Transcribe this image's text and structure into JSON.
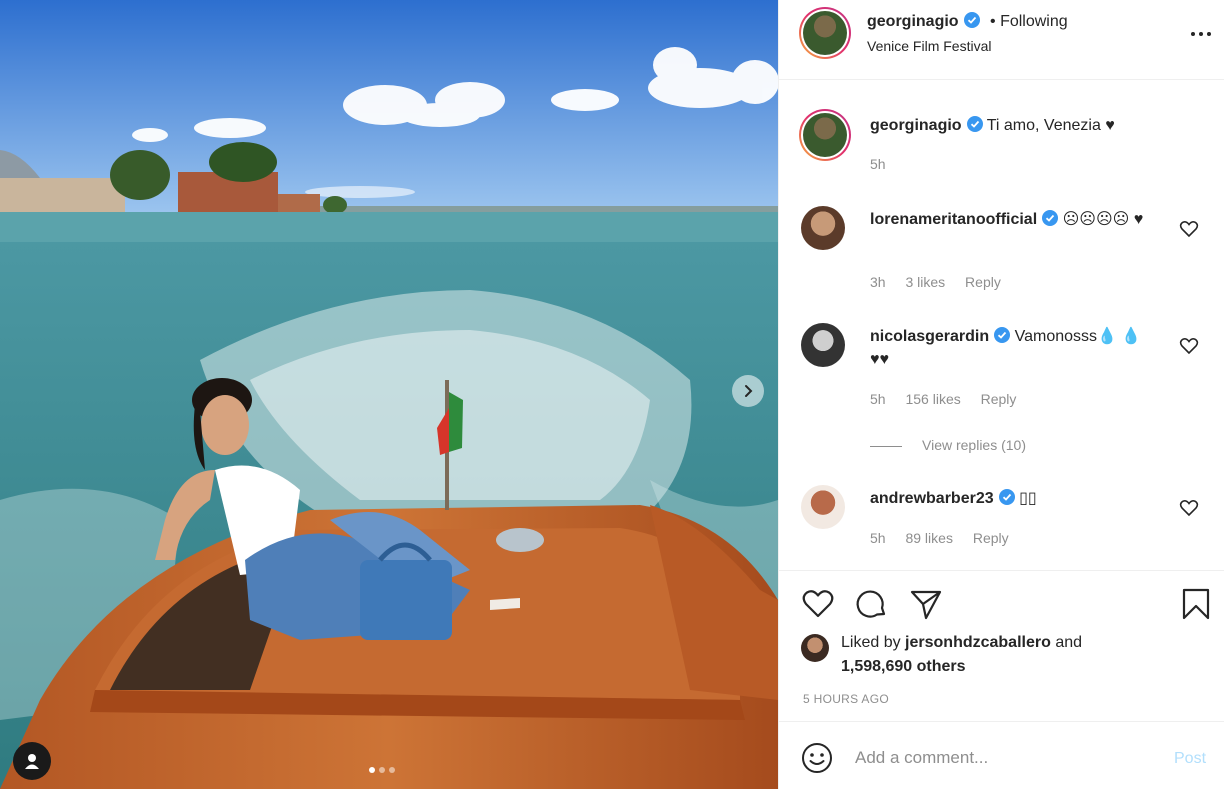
{
  "post": {
    "username": "georginagio",
    "follow_status": "• Following",
    "location": "Venice Film Festival",
    "caption": "Ti amo, Venezia ♥",
    "caption_age": "5h",
    "carousel": {
      "slides": 3,
      "active": 1
    }
  },
  "comments": [
    {
      "username": "lorenameritanoofficial",
      "text": "☹☹☹☹ ♥",
      "age": "3h",
      "likes": "3 likes",
      "reply_label": "Reply",
      "verified": true
    },
    {
      "username": "nicolasgerardin",
      "text": "Vamonosss💧 💧♥♥",
      "age": "5h",
      "likes": "156 likes",
      "reply_label": "Reply",
      "verified": true,
      "view_replies": "View replies (10)"
    },
    {
      "username": "andrewbarber23",
      "text": "▯▯",
      "age": "5h",
      "likes": "89 likes",
      "reply_label": "Reply",
      "verified": true
    }
  ],
  "likes": {
    "prefix": "Liked by",
    "user": "jersonhdzcaballero",
    "connector": "and",
    "others": "1,598,690 others"
  },
  "timestamp": "5 HOURS AGO",
  "comment_box": {
    "placeholder": "Add a comment...",
    "post_label": "Post"
  },
  "colors": {
    "verified": "#3897f0",
    "post_disabled": "#b2dffc",
    "muted": "#8e8e8e"
  },
  "icons": [
    "more-options-icon",
    "heart-icon",
    "comment-icon",
    "share-icon",
    "bookmark-icon",
    "emoji-icon",
    "verified-icon",
    "next-arrow-icon",
    "user-tag-icon"
  ]
}
